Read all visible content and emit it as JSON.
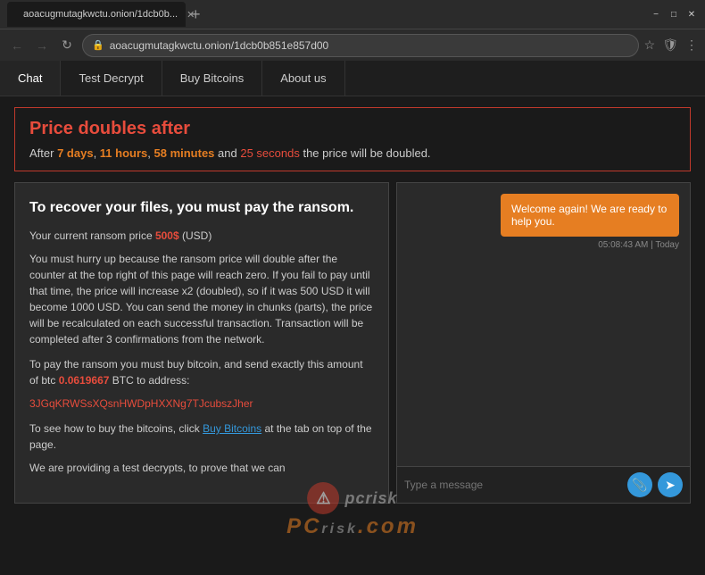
{
  "browser": {
    "tab_title": "aoacugmutagkwctu.onion/1dcb0b...",
    "url": "aoacugmutagkwctu.onion/1dcb0b851e857d00",
    "new_tab_label": "+",
    "back_disabled": true,
    "forward_disabled": true
  },
  "nav": {
    "tabs": [
      {
        "label": "Chat",
        "active": true
      },
      {
        "label": "Test Decrypt",
        "active": false
      },
      {
        "label": "Buy Bitcoins",
        "active": false
      },
      {
        "label": "About us",
        "active": false
      }
    ]
  },
  "price_alert": {
    "title": "Price doubles after",
    "text_before": "After ",
    "days": "7 days",
    "comma1": ", ",
    "hours": "11 hours",
    "comma2": ", ",
    "minutes": "58 minutes",
    "and": " and ",
    "seconds": "25 seconds",
    "text_after": " the price will be doubled."
  },
  "ransom": {
    "title": "To recover your files, you must pay the ransom.",
    "price_label": "Your current ransom price ",
    "price": "500$",
    "price_unit": " (USD)",
    "body1": "You must hurry up because the ransom price will double after the counter at the top right of this page will reach zero. If you fail to pay until that time, the price will increase x2 (doubled), so if it was 500 USD it will become 1000 USD. You can send the money in chunks (parts), the price will be recalculated on each successful transaction.\nTransaction will be completed after 3 confirmations from the network.",
    "body2": "To pay the ransom you must buy bitcoin, and send exactly this amount of btc ",
    "btc_amount": "0.0619667",
    "btc_suffix": " BTC to address:",
    "address": "3JGqKRWSsXQsnHWDpHXXNg7TJcubszJher",
    "body3_before": "To see how to buy the bitcoins, click ",
    "buy_link": "Buy Bitcoins",
    "body3_after": " at the tab on top of the page.",
    "body4": "We are providing a test decrypts, to prove that we can"
  },
  "chat": {
    "message": "Welcome again! We are ready to help you.",
    "timestamp": "05:08:43 AM | Today",
    "input_placeholder": "Type a message"
  },
  "watermark": {
    "site": "PC RISK.COM"
  }
}
